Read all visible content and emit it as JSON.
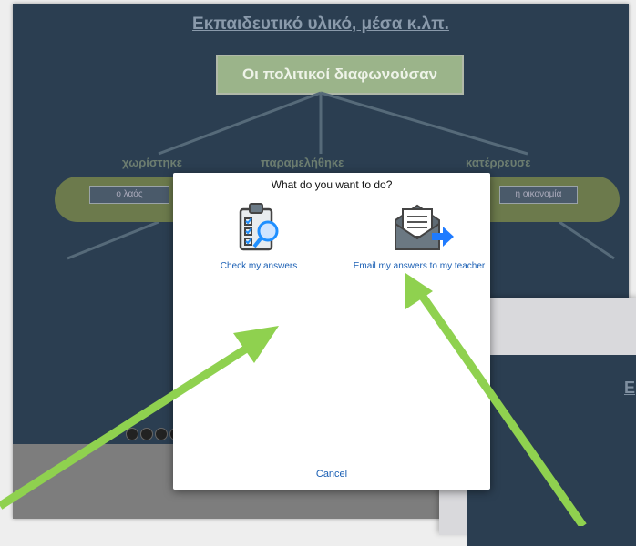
{
  "worksheet": {
    "title": "Εκπαιδευτικό υλικό, μέσα κ.λπ.",
    "main_box": "Οι πολιτικοί διαφωνούσαν",
    "branches": [
      "χωρίστηκε",
      "παραμελήθηκε",
      "κατέρρευσε"
    ],
    "blanks": [
      "ο λαός",
      "η οικονομία"
    ]
  },
  "dialog": {
    "title": "What do you want to do?",
    "check_label": "Check my answers",
    "email_label": "Email my answers to my teacher",
    "cancel_label": "Cancel"
  },
  "icons": {
    "check": "clipboard-checklist-magnifier-icon",
    "email": "envelope-send-arrow-icon"
  },
  "colors": {
    "sheet_blue": "#2b3e51",
    "arrow_green": "#8fd14f",
    "link_blue": "#1a5fb4"
  }
}
